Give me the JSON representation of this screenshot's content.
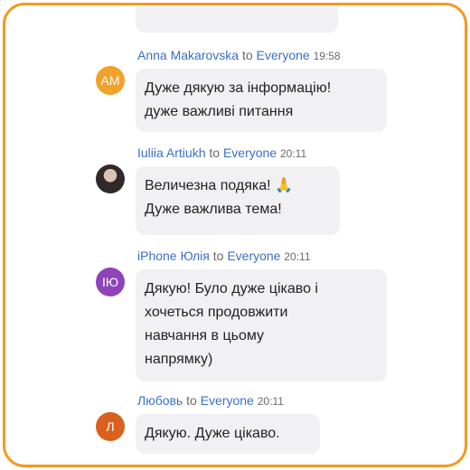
{
  "colors": {
    "frame": "#f39a20",
    "name": "#3a6fc8",
    "bubble": "#f1f1f3",
    "avatar_am": "#f2a12b",
    "avatar_yu": "#8e44b8",
    "avatar_l": "#d9611d"
  },
  "messages": [
    {
      "sender": "Anna Makarovska",
      "to": "to",
      "recipient": "Everyone",
      "time": "19:58",
      "avatar": {
        "initials": "AM",
        "color": "#f2a12b"
      },
      "lines": [
        "Дуже дякую за інформацію!",
        "дуже важливі питання"
      ]
    },
    {
      "sender": "Iuliia Artiukh",
      "to": "to",
      "recipient": "Everyone",
      "time": "20:11",
      "avatar": {
        "initials": "",
        "type": "photo",
        "icon": "profile-photo"
      },
      "lines": [
        "Величезна подяка!",
        "Дуже важлива тема!"
      ],
      "emoji": "🙏",
      "emoji_icon": "folded-hands-icon"
    },
    {
      "sender": "iPhone Юлія",
      "to": "to",
      "recipient": "Everyone",
      "time": "20:11",
      "avatar": {
        "initials": "ІЮ",
        "color": "#8e44b8"
      },
      "lines": [
        "Дякую! Було дуже цікаво і",
        "хочеться продовжити",
        "навчання в цьому",
        "напрямку)"
      ]
    },
    {
      "sender": "Любовь",
      "to": "to",
      "recipient": "Everyone",
      "time": "20:11",
      "avatar": {
        "initials": "Л",
        "color": "#d9611d"
      },
      "lines": [
        "Дякую. Дуже цікаво."
      ]
    }
  ]
}
